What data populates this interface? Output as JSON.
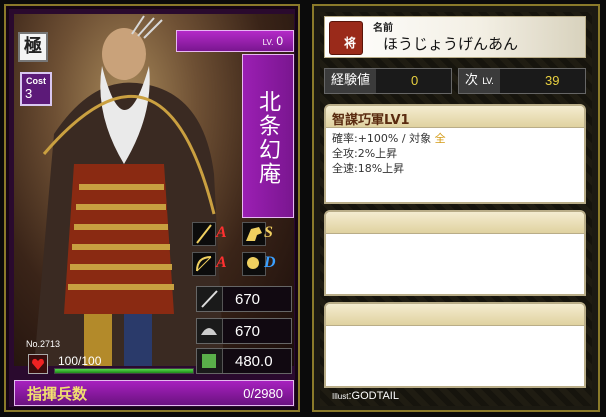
{
  "card": {
    "rarity": "極",
    "cost_label": "Cost",
    "cost": "3",
    "level_label": "LV.",
    "level": "0",
    "name": "北条幻庵",
    "card_no_label": "No.",
    "card_no": "2713",
    "hp": "100/100",
    "hp_fraction": 1.0,
    "stats": {
      "attack": "670",
      "defense": "670",
      "speed": "480.0"
    },
    "skill_badges": [
      "S",
      "D"
    ],
    "skill_marks": [
      "A",
      "A"
    ],
    "troops_label": "指揮兵数",
    "troops_value": "0/2980"
  },
  "info": {
    "name_label": "名前",
    "name_reading": "ほうじょうげんあん",
    "kanji_icon": "将",
    "exp_label": "経験値",
    "exp_value": "0",
    "next_label": "次",
    "next_lv": "LV.",
    "next_value": "39",
    "skill1": {
      "title": "智謀巧軍LV1",
      "line1_a": "確率:+100% / 対象 ",
      "line1_b": "全",
      "line2": "全攻:2%上昇",
      "line3": "全速:18%上昇"
    },
    "illust_label": "Illust",
    "illust_name": ":GODTAIL"
  },
  "colors": {
    "accent_purple": "#9b1fb3",
    "gold_text": "#f1e070",
    "exp_yellow": "#e8d040",
    "hp_green": "#1f8a1a"
  }
}
